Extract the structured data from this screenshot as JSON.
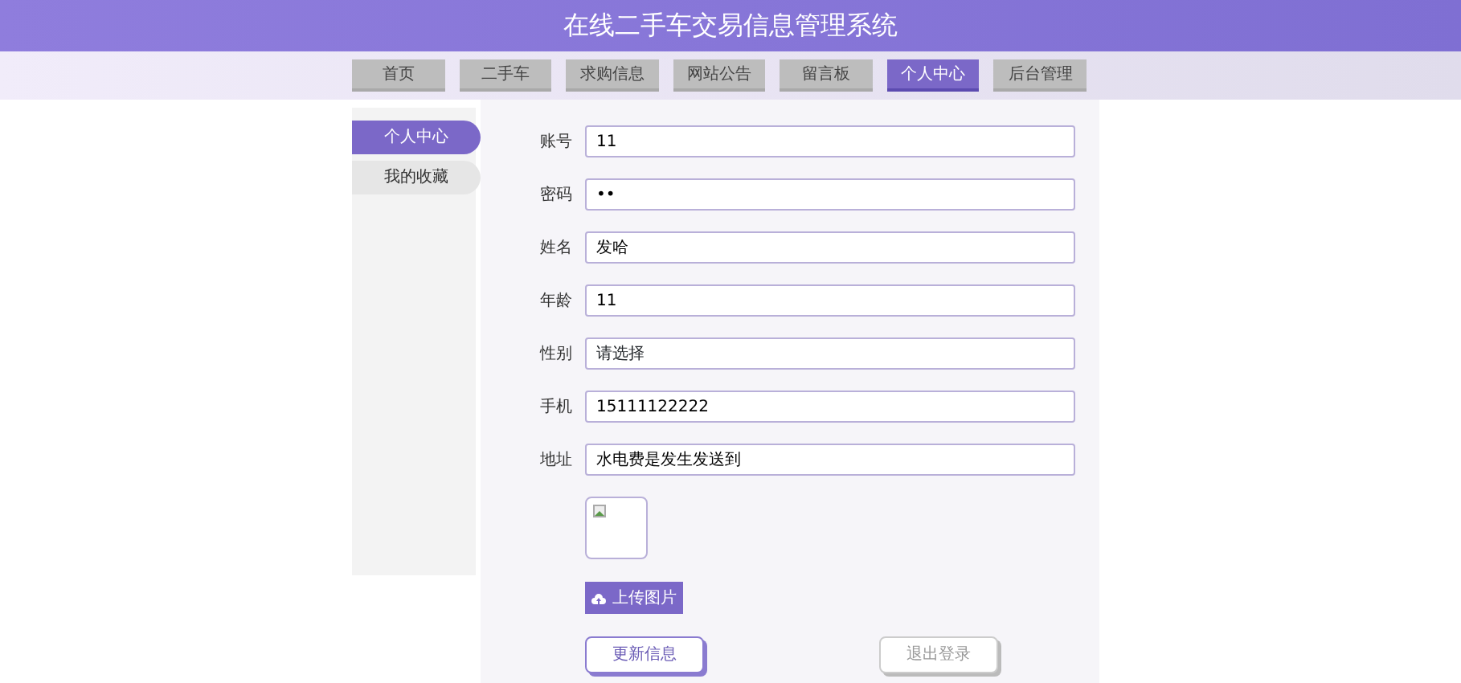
{
  "title": "在线二手车交易信息管理系统",
  "nav": [
    {
      "label": "首页",
      "selected": false
    },
    {
      "label": "二手车",
      "selected": false
    },
    {
      "label": "求购信息",
      "selected": false
    },
    {
      "label": "网站公告",
      "selected": false
    },
    {
      "label": "留言板",
      "selected": false
    },
    {
      "label": "个人中心",
      "selected": true
    },
    {
      "label": "后台管理",
      "selected": false
    }
  ],
  "sidebar": [
    {
      "label": "个人中心",
      "selected": true
    },
    {
      "label": "我的收藏",
      "selected": false
    }
  ],
  "form": {
    "fields": [
      {
        "label": "账号",
        "kind": "text",
        "value": "11"
      },
      {
        "label": "密码",
        "kind": "text",
        "value": "••"
      },
      {
        "label": "姓名",
        "kind": "text",
        "value": "发哈"
      },
      {
        "label": "年龄",
        "kind": "text",
        "value": "11"
      },
      {
        "label": "性别",
        "kind": "select",
        "placeholder": "请选择"
      },
      {
        "label": "手机",
        "kind": "text",
        "value": "15111122222"
      },
      {
        "label": "地址",
        "kind": "text",
        "value": "水电费是发生发送到"
      }
    ],
    "upload_button": "上传图片",
    "buttons": [
      {
        "label": "更新信息",
        "kind": "primary"
      },
      {
        "label": "退出登录",
        "kind": "secondary"
      }
    ]
  }
}
